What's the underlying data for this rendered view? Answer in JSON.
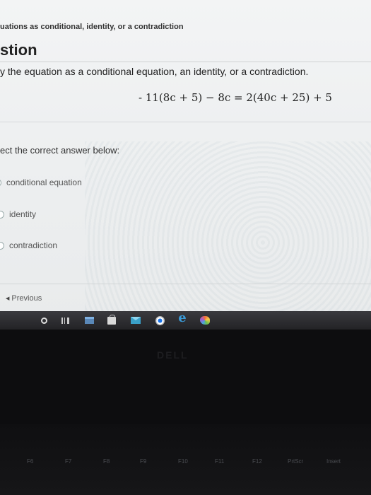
{
  "page": {
    "breadcrumb": "uations as conditional, identity, or a contradiction",
    "heading": "stion"
  },
  "question": {
    "instruction": "y the equation as a conditional equation, an identity, or a contradiction.",
    "equation": "- 11(8c + 5) − 8c = 2(40c + 25) + 5",
    "prompt": "ect the correct answer below:",
    "options": [
      {
        "label": "conditional equation"
      },
      {
        "label": "identity"
      },
      {
        "label": "contradiction"
      }
    ]
  },
  "nav": {
    "previous": "Previous"
  },
  "taskbar": {
    "icons": [
      "start-icon",
      "task-view-icon",
      "file-explorer-icon",
      "store-icon",
      "mail-icon",
      "chrome-icon",
      "edge-icon",
      "paint-icon"
    ],
    "edge_glyph": "e"
  },
  "laptop": {
    "brand": "DELL",
    "fkeys": [
      "F6",
      "F7",
      "F8",
      "F9",
      "F10",
      "F11",
      "F12",
      "PrtScr",
      "Insert"
    ]
  },
  "colors": {
    "screen_bg": "#eef0f1",
    "taskbar_bg": "#2d2d31",
    "text": "#222222"
  }
}
